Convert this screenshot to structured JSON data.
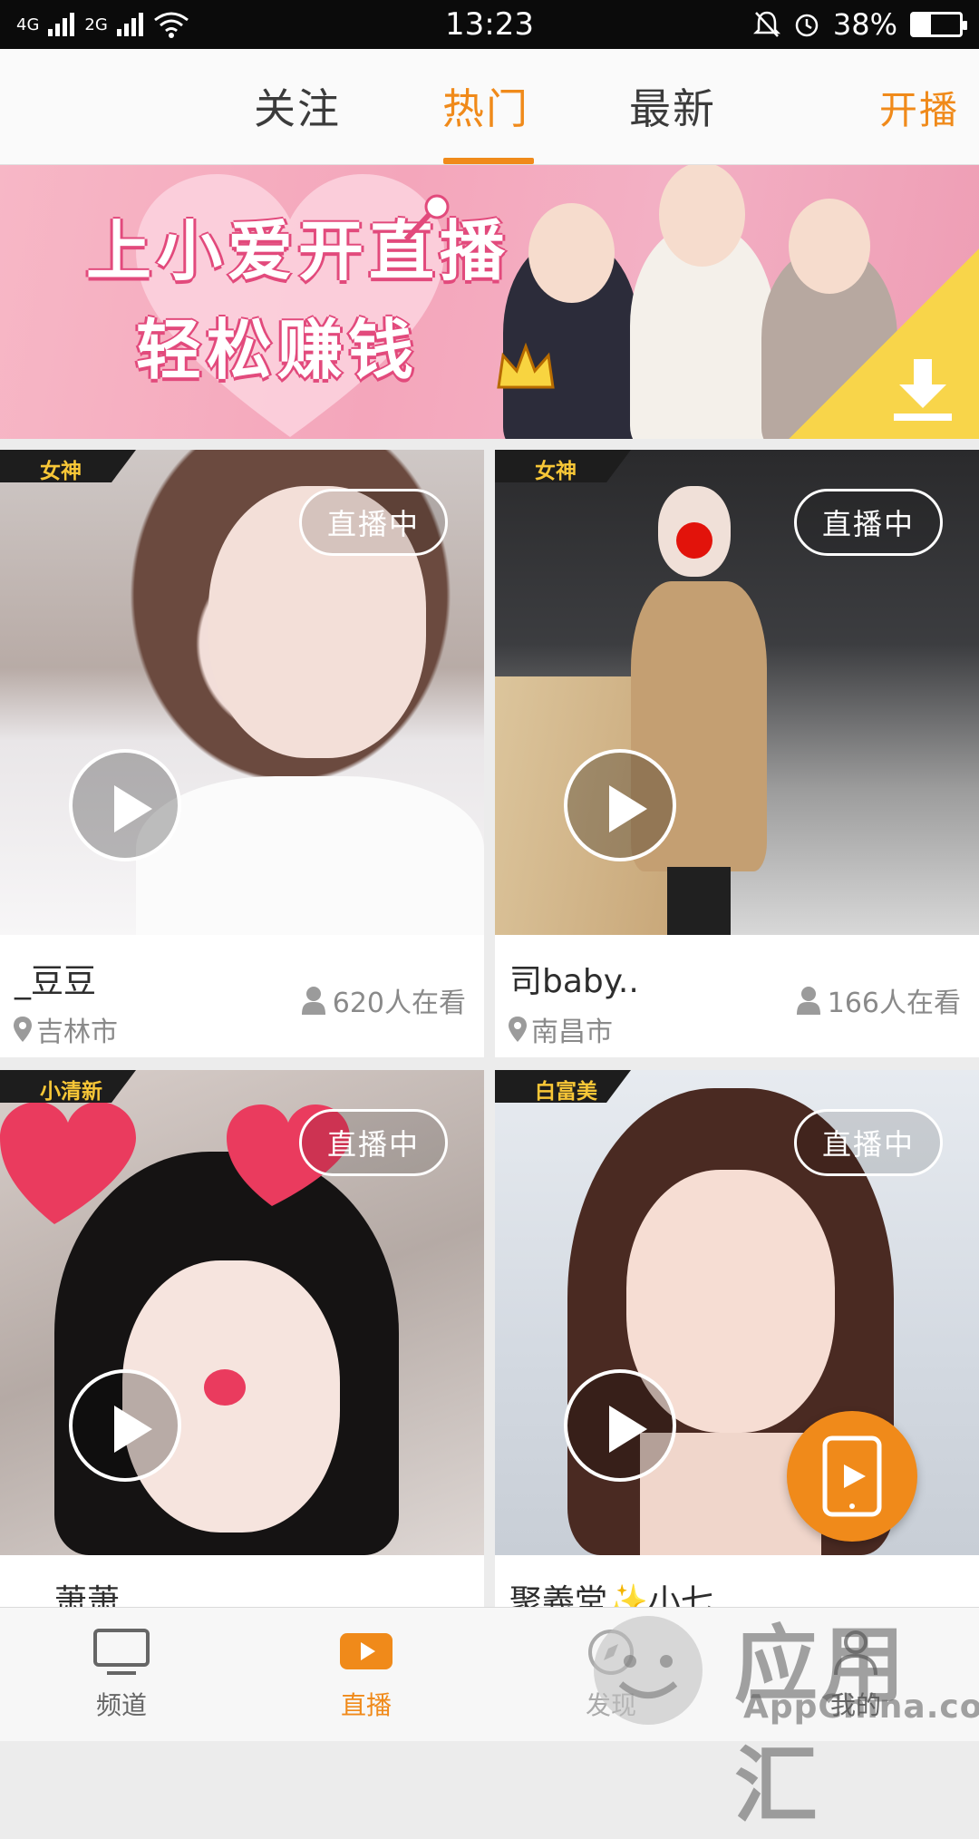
{
  "status_bar": {
    "network_left": "4G",
    "network_right": "2G",
    "time": "13:23",
    "battery_text": "38%",
    "battery_level": 0.38
  },
  "top_tabs": [
    {
      "label": "关注",
      "active": false
    },
    {
      "label": "热门",
      "active": true
    },
    {
      "label": "最新",
      "active": false
    }
  ],
  "start_live_label": "开播",
  "banner": {
    "title_line1": "上小爱开直播",
    "title_line2": "轻松赚钱",
    "pages": 6,
    "active_page": 2
  },
  "cards": [
    {
      "tag": "女神",
      "live_label": "直播中",
      "name": "_豆豆",
      "city": "吉林市",
      "viewers": "620人在看"
    },
    {
      "tag": "女神",
      "live_label": "直播中",
      "name": "司baby..",
      "city": "南昌市",
      "viewers": "166人在看"
    },
    {
      "tag": "小清新",
      "live_label": "直播中",
      "name": "萧萧",
      "city": "",
      "viewers": ""
    },
    {
      "tag": "白富美",
      "live_label": "直播中",
      "name": "聚義堂✨小七",
      "city": "",
      "viewers": ""
    }
  ],
  "bottom_nav": [
    {
      "label": "频道",
      "icon": "tv-icon",
      "active": false
    },
    {
      "label": "直播",
      "icon": "play-icon",
      "active": true
    },
    {
      "label": "发现",
      "icon": "compass-icon",
      "active": false
    },
    {
      "label": "我的",
      "icon": "person-icon",
      "active": false
    }
  ],
  "watermark": {
    "big": "应用汇",
    "small": "AppChina.com"
  },
  "colors": {
    "accent": "#f08a1a",
    "tag_text": "#f8c737"
  }
}
